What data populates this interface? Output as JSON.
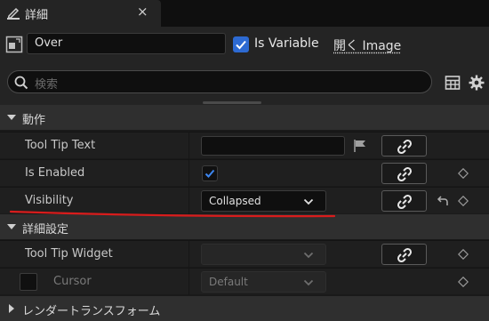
{
  "tab": {
    "title": "詳細",
    "close": "×"
  },
  "header": {
    "name_value": "Over",
    "is_variable_label": "Is Variable",
    "is_variable_checked": true,
    "open_image_label": "開く Image"
  },
  "search": {
    "placeholder": "検索"
  },
  "categories": {
    "behavior": "動作",
    "advanced": "詳細設定",
    "render_transform": "レンダートランスフォーム"
  },
  "properties": {
    "tool_tip_text": {
      "label": "Tool Tip Text",
      "value": ""
    },
    "is_enabled": {
      "label": "Is Enabled",
      "checked": true
    },
    "visibility": {
      "label": "Visibility",
      "value": "Collapsed"
    },
    "tool_tip_widget": {
      "label": "Tool Tip Widget",
      "value": ""
    },
    "cursor": {
      "label": "Cursor",
      "value": "Default"
    }
  },
  "colors": {
    "panel_bg": "#242424",
    "row_bg": "#1f1f1f",
    "category_bg": "#2f2f2f",
    "accent_blue": "#2d6ad2",
    "annotation_red": "#d81c1c"
  }
}
